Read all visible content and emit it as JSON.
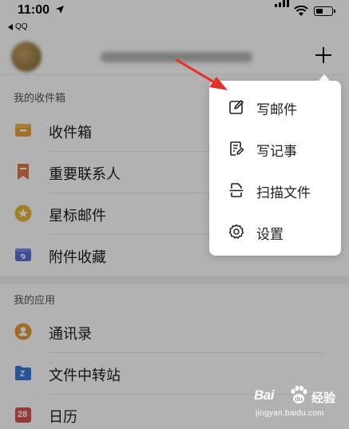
{
  "status_bar": {
    "time": "11:00",
    "back_app": "QQ",
    "battery_level_fraction": 0.45
  },
  "header": {
    "add_button_symbol": "+"
  },
  "sections": [
    {
      "title": "我的收件箱",
      "items": [
        {
          "label": "收件箱",
          "icon": "inbox-icon",
          "color": "#e8a23c"
        },
        {
          "label": "重要联系人",
          "icon": "bookmark-icon",
          "color": "#e07845"
        },
        {
          "label": "星标邮件",
          "icon": "star-icon",
          "color": "#e6b832"
        },
        {
          "label": "附件收藏",
          "icon": "attachment-icon",
          "color": "#5b6fd8"
        }
      ]
    },
    {
      "title": "我的应用",
      "items": [
        {
          "label": "通讯录",
          "icon": "contacts-icon",
          "color": "#e39b32"
        },
        {
          "label": "文件中转站",
          "icon": "file-transfer-icon",
          "color": "#3c78d8",
          "icon_text": "Z"
        },
        {
          "label": "日历",
          "icon": "calendar-icon",
          "color": "#d9534f",
          "icon_text": "28"
        }
      ]
    }
  ],
  "popup_menu": {
    "items": [
      {
        "label": "写邮件",
        "icon": "compose-icon"
      },
      {
        "label": "写记事",
        "icon": "note-icon"
      },
      {
        "label": "扫描文件",
        "icon": "scan-icon"
      },
      {
        "label": "设置",
        "icon": "gear-icon"
      }
    ]
  },
  "colors": {
    "annotation_arrow": "#e8302a",
    "overlay": "rgba(0,0,0,0.30)"
  },
  "watermark": {
    "logo": "Bai",
    "brand": "经验",
    "url": "jingyan.baidu.com"
  }
}
